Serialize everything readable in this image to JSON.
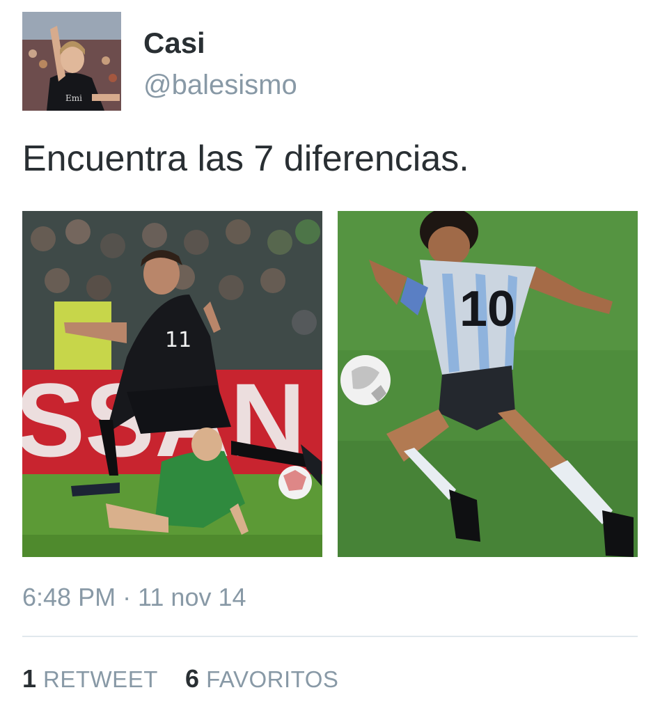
{
  "author": {
    "display_name": "Casi",
    "username": "@balesismo"
  },
  "tweet": {
    "text": "Encuentra las 7 diferencias.",
    "timestamp": "6:48 PM · 11 nov 14"
  },
  "media": {
    "left_photo": {
      "sign_text": "SSAN",
      "jersey_number": "11"
    },
    "right_photo": {
      "jersey_number": "10"
    }
  },
  "stats": {
    "retweets_count": "1",
    "retweets_label": "RETWEET",
    "favorites_count": "6",
    "favorites_label": "FAVORITOS"
  },
  "colors": {
    "text_primary": "#292f33",
    "text_secondary": "#8899a6",
    "divider": "#e1e8ed"
  }
}
